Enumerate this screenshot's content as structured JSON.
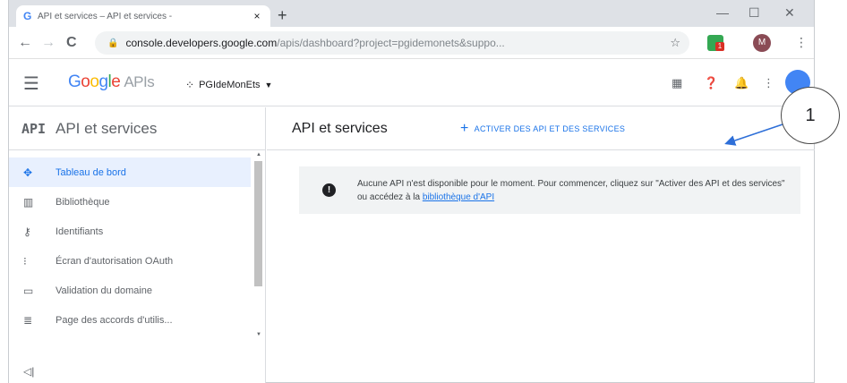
{
  "browser": {
    "tab_title": "API et services – API et services -",
    "tab_favicon": "G",
    "close_glyph": "×",
    "newtab_glyph": "+",
    "minimize_glyph": "—",
    "maximize_glyph": "☐",
    "windowclose_glyph": "✕",
    "back_glyph": "←",
    "forward_glyph": "→",
    "reload_glyph": "C",
    "lock_glyph": "🔒",
    "url_host": "console.developers.google.com",
    "url_path": "/apis/dashboard?project=pgidemonets&suppo...",
    "star_glyph": "☆",
    "extension_badge": "1",
    "profile_initial": "M",
    "menu_glyph": "⋮"
  },
  "header": {
    "menu_glyph": "☰",
    "logo": {
      "g": "G",
      "o1": "o",
      "o2": "o",
      "g2": "g",
      "l": "l",
      "e": "e",
      "apis": "APIs"
    },
    "project_dots": "⁘",
    "project_name": "PGIdeMonEts",
    "project_caret": "▼",
    "gift_glyph": "▦",
    "help_glyph": "❓",
    "bell_glyph": "🔔",
    "more_glyph": "⋮"
  },
  "callout": {
    "label": "1"
  },
  "sidebar": {
    "api_mark": "API",
    "title": "API et services",
    "items": [
      {
        "label": "Tableau de bord",
        "icon": "✥"
      },
      {
        "label": "Bibliothèque",
        "icon": "▥"
      },
      {
        "label": "Identifiants",
        "icon": "⚷"
      },
      {
        "label": "Écran d'autorisation OAuth",
        "icon": "⁝"
      },
      {
        "label": "Validation du domaine",
        "icon": "▭"
      },
      {
        "label": "Page des accords d'utilis...",
        "icon": "≣"
      }
    ],
    "collapse_glyph": "◁|",
    "scroll_up": "▲",
    "scroll_down": "▼"
  },
  "main": {
    "title": "API et services",
    "enable_plus": "+",
    "enable_label": "ACTIVER DES API ET DES SERVICES",
    "info_icon": "!",
    "info_text": "Aucune API n'est disponible pour le moment. Pour commencer, cliquez sur \"Activer des API et des services\" ou accédez à la ",
    "info_link": "bibliothèque d'API"
  },
  "colors": {
    "accent": "#1a73e8",
    "active_bg": "#e8f0fe",
    "info_bg": "#f1f3f4",
    "tabstrip_bg": "#dee1e6"
  }
}
